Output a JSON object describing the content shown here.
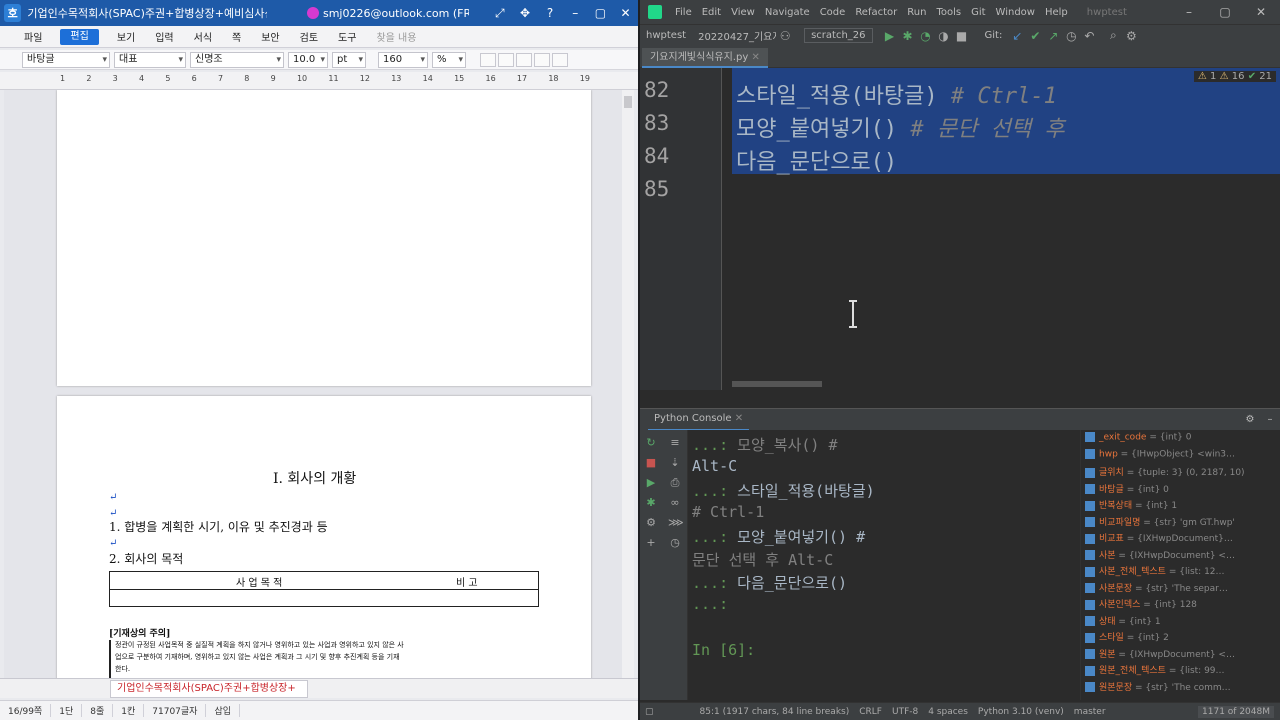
{
  "hwp": {
    "title": "기업인수목적회사(SPAC)주권+합병상장+예비심사신청…",
    "account": "smj0226@outlook.com (FREE…",
    "menu": [
      "파일",
      "편집",
      "보기",
      "입력",
      "서식",
      "쪽",
      "보안",
      "검토",
      "도구",
      "찾을 내용"
    ],
    "style_select": "바탕글",
    "lang_select": "대표",
    "font_select": "신명조",
    "font_size": "10.0",
    "font_unit": "pt",
    "line_spacing": "160",
    "line_unit": "%",
    "ruler": [
      "1",
      "2",
      "3",
      "4",
      "5",
      "6",
      "7",
      "8",
      "9",
      "10",
      "11",
      "12",
      "13",
      "14",
      "15",
      "16",
      "17",
      "18",
      "19"
    ],
    "doc": {
      "heading": "Ⅰ. 회사의 개황",
      "item1": "1. 합병을 계획한 시기, 이유 및 추진경과 등",
      "item2": "2. 회사의 목적",
      "table_col1": "사 업 목 적",
      "table_col2": "비 고",
      "note_title": "[기재상의 주의]",
      "note_body1": "정관이 규정된 사업목적 중 실질적 계획을 하지 않거나 영위하고 있는 사업과 영위하고 있지 않은 사",
      "note_body2": "업으로 구분하여 기재하며, 영위하고 있지 않는 사업은 계획과 그 시기 및 향후 추진계획 등을 기재",
      "note_body3": "한다."
    },
    "doc_tab": "기업인수목적회사(SPAC)주권+합병상장+",
    "status": [
      "16/99쪽",
      "1단",
      "8줄",
      "1칸",
      "71707글자",
      "삽입"
    ]
  },
  "ide": {
    "menu": [
      "File",
      "Edit",
      "View",
      "Navigate",
      "Code",
      "Refactor",
      "Run",
      "Tools",
      "Git",
      "Window",
      "Help"
    ],
    "project_name": "hwptest",
    "breadcrumb": [
      "hwptest",
      "20220427_기요지게빛시"
    ],
    "run_config": "scratch_26",
    "git_label": "Git:",
    "file_tab": "기요지게빛식식유지.py",
    "warnings": {
      "w1": "1",
      "w2": "16",
      "w3": "21"
    },
    "lines": [
      {
        "num": "82",
        "code": "        스타일_적용(바탕글)",
        "comment": "  # Ctrl-1"
      },
      {
        "num": "83",
        "code": "        모양_붙여넣기()",
        "comment": "  # 문단 선택 후"
      },
      {
        "num": "84",
        "code": "    다음_문단으로()",
        "comment": ""
      },
      {
        "num": "85",
        "code": "",
        "comment": ""
      }
    ],
    "console_tab": "Python Console",
    "console": [
      {
        "prompt": "...:",
        "text": "               모양_복사()  #",
        "cls": "cm"
      },
      {
        "prompt": "",
        "text": "  Alt-C",
        "cls": ""
      },
      {
        "prompt": "...:",
        "text": "               스타일_적용(바탕글)",
        "cls": ""
      },
      {
        "prompt": "",
        "text": "    # Ctrl-1",
        "cls": "cm"
      },
      {
        "prompt": "...:",
        "text": "               모양_붙여넣기()  #",
        "cls": ""
      },
      {
        "prompt": "",
        "text": "   문단 선택 후 Alt-C",
        "cls": "cm"
      },
      {
        "prompt": "...:",
        "text": "           다음_문단으로()",
        "cls": ""
      },
      {
        "prompt": "...:",
        "text": "",
        "cls": ""
      },
      {
        "prompt": "",
        "text": "",
        "cls": ""
      },
      {
        "prompt": "In [6]:",
        "text": "",
        "cls": ""
      }
    ],
    "variables": [
      {
        "name": "_exit_code",
        "val": "= {int} 0"
      },
      {
        "name": "hwp",
        "val": "= {IHwpObject} <win3…"
      },
      {
        "name": "글위치",
        "val": "= {tuple: 3} (0, 2187, 10)"
      },
      {
        "name": "바탕글",
        "val": "= {int} 0"
      },
      {
        "name": "반복상태",
        "val": "= {int} 1"
      },
      {
        "name": "비교파일명",
        "val": "= {str} 'gm GT.hwp'"
      },
      {
        "name": "비교표",
        "val": "= {IXHwpDocument}…"
      },
      {
        "name": "사본",
        "val": "= {IXHwpDocument} <…"
      },
      {
        "name": "사본_전체_텍스트",
        "val": "= {list: 12…"
      },
      {
        "name": "사본문장",
        "val": "= {str} 'The separ…"
      },
      {
        "name": "사본인덱스",
        "val": "= {int} 128"
      },
      {
        "name": "상태",
        "val": "= {int} 1"
      },
      {
        "name": "스타일",
        "val": "= {int} 2"
      },
      {
        "name": "원본",
        "val": "= {IXHwpDocument} <…"
      },
      {
        "name": "원본_전체_텍스트",
        "val": "= {list: 99…"
      },
      {
        "name": "원본문장",
        "val": "= {str} 'The comm…"
      }
    ],
    "view_label": "View",
    "status": [
      "85:1 (1917 chars, 84 line breaks)",
      "CRLF",
      "UTF-8",
      "4 spaces",
      "Python 3.10 (venv)",
      "master"
    ],
    "memory": "1171 of 2048M"
  }
}
